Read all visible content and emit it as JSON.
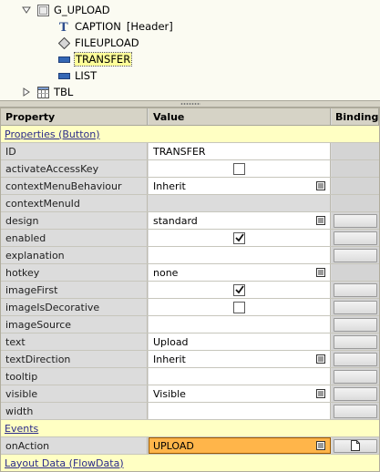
{
  "tree": {
    "nodes": [
      {
        "label": "G_UPLOAD",
        "icon": "group-icon",
        "toggle": "expanded"
      },
      {
        "label": "CAPTION",
        "extra": "[Header]",
        "icon": "caption-t-icon"
      },
      {
        "label": "FILEUPLOAD",
        "icon": "diamond-icon"
      },
      {
        "label": "TRANSFER",
        "icon": "button-icon",
        "selected": true
      },
      {
        "label": "LIST",
        "icon": "button-icon"
      },
      {
        "label": "TBL",
        "icon": "table-icon",
        "toggle": "collapsed"
      }
    ]
  },
  "table": {
    "headers": {
      "property": "Property",
      "value": "Value",
      "binding": "Binding"
    },
    "groups": {
      "properties": "Properties (Button)",
      "events": "Events",
      "layout": "Layout Data (FlowData)"
    },
    "rows": [
      {
        "name": "ID",
        "value": "TRANSFER"
      },
      {
        "name": "activateAccessKey",
        "value": "",
        "checkbox": "unchecked"
      },
      {
        "name": "contextMenuBehaviour",
        "value": "Inherit",
        "dropdown": true
      },
      {
        "name": "contextMenuId",
        "value": ""
      },
      {
        "name": "design",
        "value": "standard",
        "dropdown": true
      },
      {
        "name": "enabled",
        "value": "",
        "checkbox": "checked"
      },
      {
        "name": "explanation",
        "value": ""
      },
      {
        "name": "hotkey",
        "value": "none",
        "dropdown": true
      },
      {
        "name": "imageFirst",
        "value": "",
        "checkbox": "checked"
      },
      {
        "name": "imageIsDecorative",
        "value": "",
        "checkbox": "unchecked"
      },
      {
        "name": "imageSource",
        "value": ""
      },
      {
        "name": "text",
        "value": "Upload"
      },
      {
        "name": "textDirection",
        "value": "Inherit",
        "dropdown": true
      },
      {
        "name": "tooltip",
        "value": ""
      },
      {
        "name": "visible",
        "value": "Visible",
        "dropdown": true
      },
      {
        "name": "width",
        "value": ""
      }
    ],
    "events": [
      {
        "name": "onAction",
        "value": "UPLOAD",
        "dropdown": true
      }
    ]
  },
  "colors": {
    "group_row": "#ffffc3",
    "highlight": "#ffb54a",
    "header": "#d6d3c6",
    "selection": "#ffff99"
  }
}
